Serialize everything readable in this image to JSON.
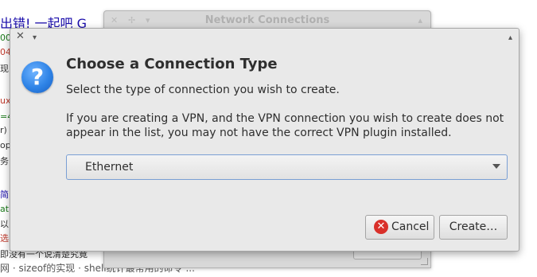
{
  "background": {
    "browser_title": "出错! 一起吧   G",
    "footer_snippet": "网 · sizeof的实现 · shell统计最常用的命令 ...",
    "side_fragments": [
      {
        "text": "00",
        "color": "#1a7a1a"
      },
      {
        "text": "04",
        "color": "#c0392b"
      },
      {
        "text": "现",
        "color": "#333333"
      },
      {
        "text": "ux",
        "color": "#c0392b"
      },
      {
        "text": "=4",
        "color": "#1a7a1a"
      },
      {
        "text": "r)",
        "color": "#333333"
      },
      {
        "text": "op",
        "color": "#333333"
      },
      {
        "text": "务",
        "color": "#333333"
      },
      {
        "text": "简",
        "color": "#1a0dab"
      },
      {
        "text": "at",
        "color": "#1a7a1a"
      },
      {
        "text": "以",
        "color": "#333333"
      },
      {
        "text": "选",
        "color": "#c0392b"
      },
      {
        "text": "即没有一个说清楚究竟",
        "color": "#333333"
      }
    ]
  },
  "back_window": {
    "title": "Network Connections"
  },
  "dialog": {
    "heading": "Choose a Connection Type",
    "description": "Select the type of connection you wish to create.",
    "note": "If you are creating a VPN, and the VPN connection you wish to create does not appear in the list, you may not have the correct VPN plugin installed.",
    "connection_type": {
      "selected": "Ethernet"
    },
    "buttons": {
      "cancel": "Cancel",
      "create": "Create…"
    },
    "titlebar": {
      "close": "✕",
      "menu": "▾",
      "maximize": "▴"
    }
  },
  "icons": {
    "info": "info-icon",
    "cancel": "cancel-icon",
    "dropdown": "chevron-down-icon"
  },
  "colors": {
    "dialog_bg": "#e9e9e9",
    "info_blue": "#2e83e6",
    "cancel_red": "#d9302a",
    "combo_focus": "#7a9fd4"
  }
}
